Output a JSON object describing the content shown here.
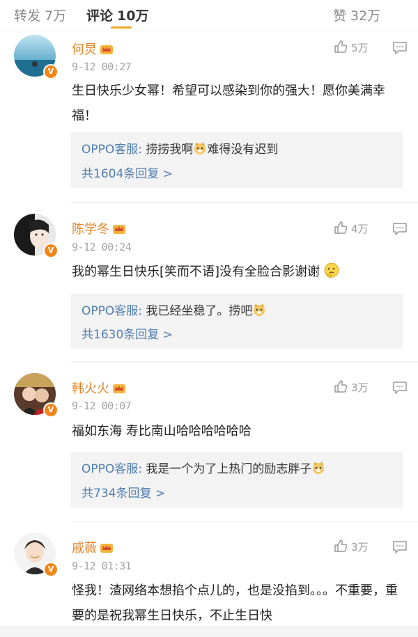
{
  "tabs": {
    "repost": {
      "label": "转发",
      "count": "7万"
    },
    "comment": {
      "label": "评论",
      "count": "10万"
    },
    "like": {
      "label": "赞",
      "count": "32万"
    }
  },
  "comments": [
    {
      "name": "何炅",
      "time": "9-12 00:27",
      "likes": "5万",
      "text": "生日快乐少女幂！希望可以感染到你的强大！愿你美满幸福！",
      "reply": {
        "user": "OPPO客服:",
        "text_before": " 捞捞我啊",
        "text_after": "难得没有迟到",
        "count": "共1604条回复 >"
      }
    },
    {
      "name": "陈学冬",
      "time": "9-12 00:24",
      "likes": "4万",
      "text": "我的幂生日快乐[笑而不语]没有全脸合影谢谢",
      "reply": {
        "user": "OPPO客服:",
        "text_before": " 我已经坐稳了。捞吧",
        "text_after": "",
        "count": "共1630条回复 >"
      }
    },
    {
      "name": "韩火火",
      "time": "9-12 00:07",
      "likes": "3万",
      "text": "福如东海 寿比南山哈哈哈哈哈哈",
      "reply": {
        "user": "OPPO客服:",
        "text_before": " 我是一个为了上热门的励志胖子",
        "text_after": "",
        "count": "共734条回复 >"
      }
    },
    {
      "name": "戚薇",
      "time": "9-12 01:31",
      "likes": "3万",
      "text": "怪我！渣网络本想掐个点儿的，也是没掐到。。。不重要，重要的是祝我幂生日快乐，不止生日快"
    }
  ],
  "icons": {
    "like": "thumbs-up-icon",
    "more": "comment-more-icon",
    "verified": "verified-v-icon",
    "crown": "crown-icon"
  },
  "colors": {
    "name": "#e3862a",
    "link": "#4e7db1",
    "accent": "#f5a623"
  }
}
